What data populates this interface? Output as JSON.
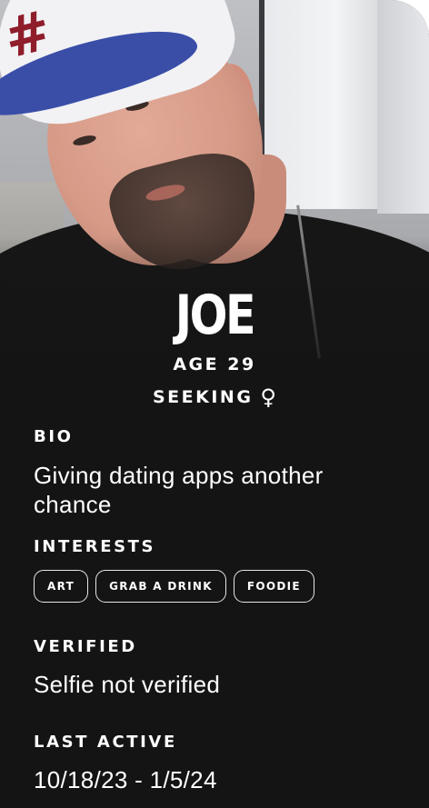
{
  "profile": {
    "name": "JOE",
    "age_label": "AGE 29",
    "seeking_label": "SEEKING",
    "seeking_icon": "female-symbol-icon",
    "seeking_symbol": "♀"
  },
  "bio": {
    "label": "BIO",
    "text": "Giving dating apps another chance"
  },
  "interests": {
    "label": "INTERESTS",
    "items": [
      "ART",
      "GRAB A DRINK",
      "FOODIE"
    ]
  },
  "verified": {
    "label": "VERIFIED",
    "text": "Selfie not verified"
  },
  "last_active": {
    "label": "LAST ACTIVE",
    "text": "10/18/23 - 1/5/24"
  },
  "colors": {
    "card_background": "#141414",
    "text": "#ffffff",
    "chip_border": "#e6e6e6"
  }
}
